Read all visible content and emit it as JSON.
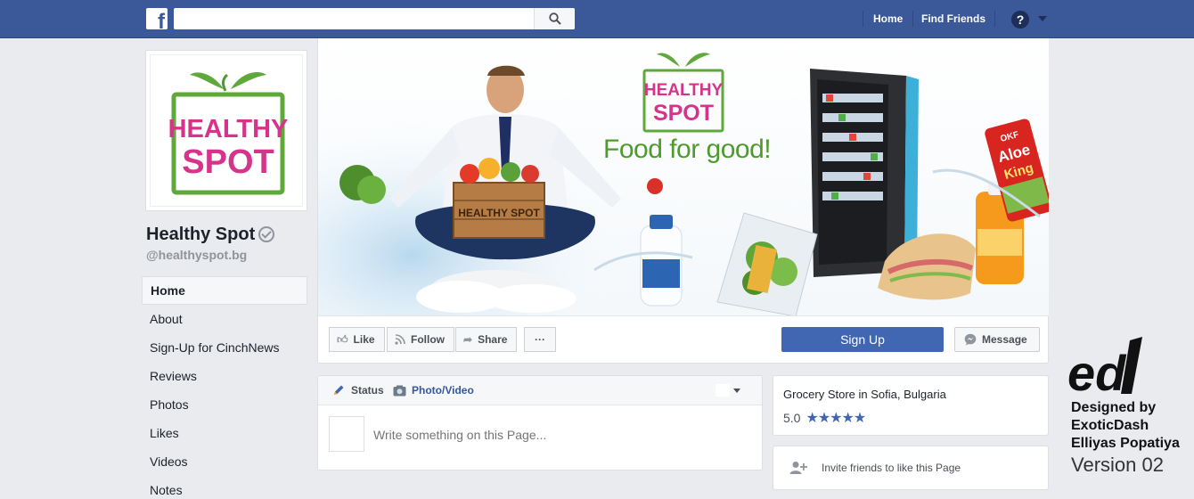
{
  "topbar": {
    "logo_letter": "f",
    "search_placeholder": "",
    "nav": [
      "Home",
      "Find Friends"
    ],
    "help_glyph": "?"
  },
  "page": {
    "name": "Healthy Spot",
    "handle": "@healthyspot.bg",
    "logo_top": "HEALTHY",
    "logo_bottom": "SPOT"
  },
  "sidebar": {
    "items": [
      {
        "label": "Home"
      },
      {
        "label": "About"
      },
      {
        "label": "Sign-Up for CinchNews"
      },
      {
        "label": "Reviews"
      },
      {
        "label": "Photos"
      },
      {
        "label": "Likes"
      },
      {
        "label": "Videos"
      },
      {
        "label": "Notes"
      }
    ]
  },
  "cover": {
    "logo_top": "HEALTHY",
    "logo_bottom": "SPOT",
    "tagline": "Food for good!",
    "crate_text": "HEALTHY SPOT",
    "drink_brand": "OKF",
    "drink_name_1": "Aloe",
    "drink_name_2": "King"
  },
  "actions": {
    "like": "Like",
    "follow": "Follow",
    "share": "Share",
    "more": "···",
    "signup": "Sign Up",
    "message": "Message"
  },
  "composer": {
    "tab_status": "Status",
    "tab_photo": "Photo/Video",
    "placeholder": "Write something on this Page..."
  },
  "info": {
    "category": "Grocery Store in Sofia, Bulgaria",
    "rating": "5.0",
    "stars": "★★★★★",
    "invite": "Invite friends to like this Page"
  },
  "watermark": {
    "logo_text": "ed",
    "line1": "Designed by",
    "line2": "ExoticDash",
    "line3": "Elliyas Popatiya",
    "line4": "Version 02"
  },
  "colors": {
    "fb_blue": "#3b5998",
    "button_blue": "#4267b2",
    "brand_green": "#4f9a2c",
    "brand_pink": "#d6338a",
    "star": "#4267b2"
  }
}
